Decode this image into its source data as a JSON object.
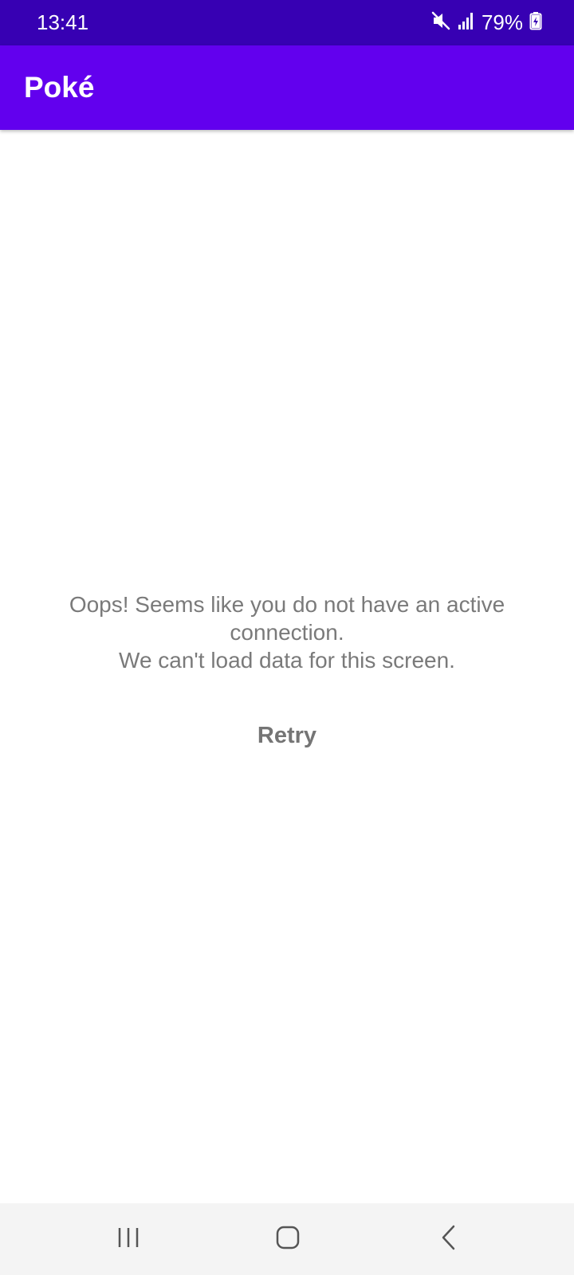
{
  "status_bar": {
    "time": "13:41",
    "battery": "79%",
    "icons": [
      "mute-icon",
      "signal-icon",
      "battery-charging-icon"
    ]
  },
  "app_bar": {
    "title": "Poké"
  },
  "error": {
    "lines": [
      "Oops! Seems like you do not have an active",
      "connection.",
      "We can't load data for this screen."
    ],
    "retry_label": "Retry"
  },
  "nav_bar": {
    "icons": [
      "recents-icon",
      "home-icon",
      "back-icon"
    ]
  },
  "colors": {
    "status_bar": "#3700b3",
    "app_bar": "#6200ee",
    "error_text": "#7a7a7a",
    "nav_bar": "#f4f4f4"
  }
}
